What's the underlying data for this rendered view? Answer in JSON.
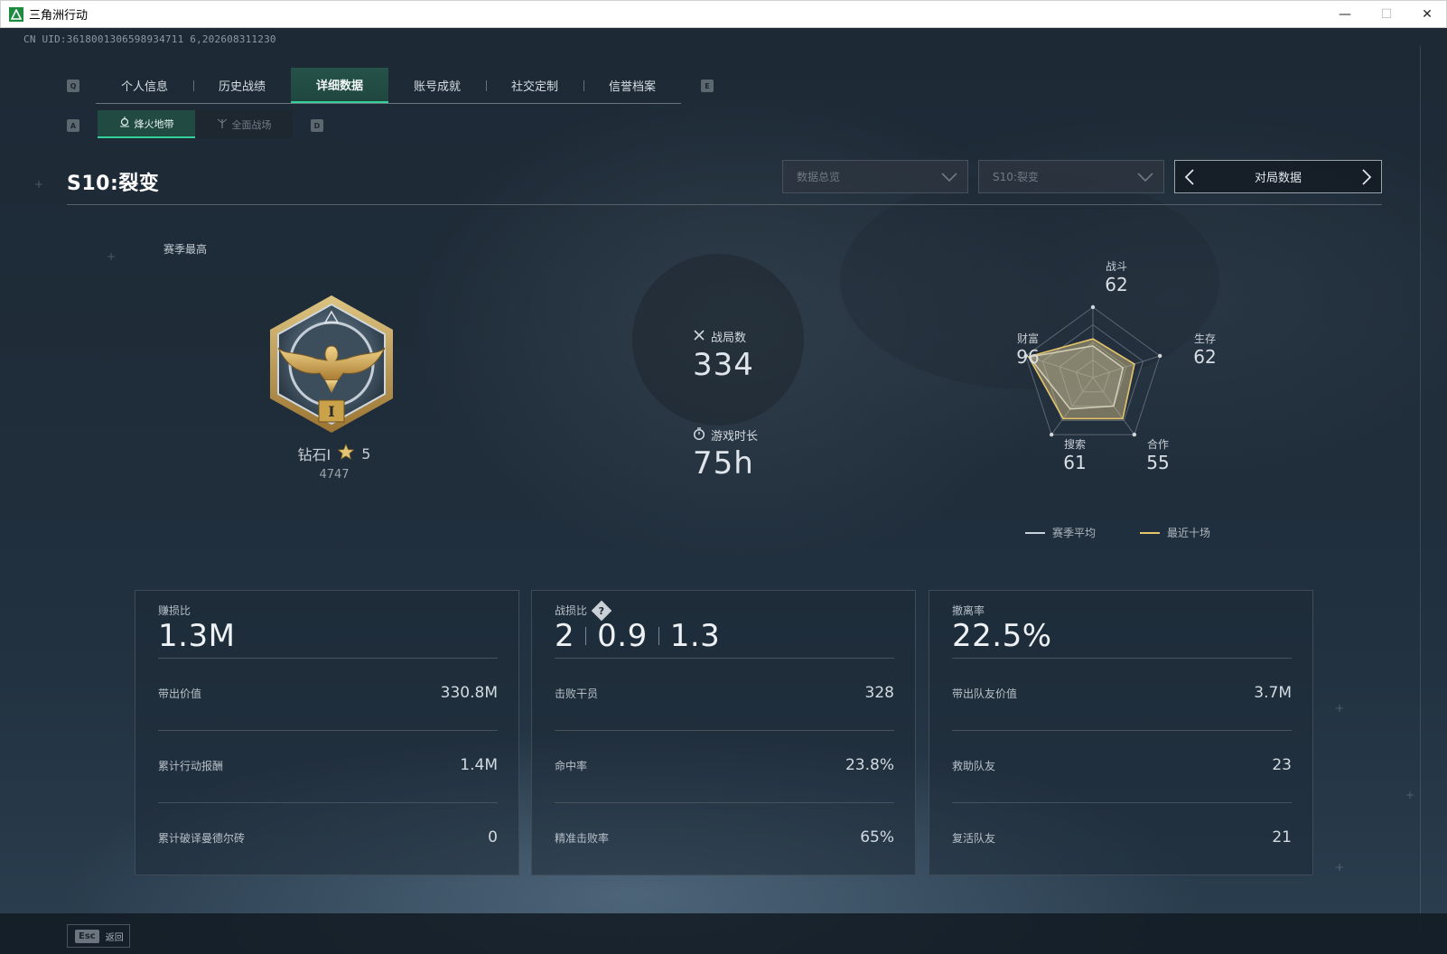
{
  "window": {
    "title": "三角洲行动",
    "minimize_glyph": "—",
    "maximize_glyph": "☐",
    "close_glyph": "✕"
  },
  "header": {
    "uid": "CN UID:3618001306598934711 6,202608311230",
    "key_q": "Q",
    "key_e": "E",
    "key_a": "A",
    "key_d": "D"
  },
  "tabs": [
    {
      "label": "个人信息"
    },
    {
      "label": "历史战绩"
    },
    {
      "label": "详细数据",
      "active": true
    },
    {
      "label": "账号成就"
    },
    {
      "label": "社交定制"
    },
    {
      "label": "信誉档案"
    }
  ],
  "subtabs": [
    {
      "label": "烽火地带",
      "icon": "crosshair-icon",
      "active": true
    },
    {
      "label": "全面战场",
      "icon": "antenna-icon"
    }
  ],
  "season": {
    "title": "S10:裂变",
    "dropdown_overview": "数据总览",
    "dropdown_season": "S10:裂变",
    "pager_label": "对局数据"
  },
  "rank": {
    "section_label": "赛季最高",
    "rank_name": "钻石I",
    "stars": "5",
    "points": "4747",
    "medal_numeral": "I"
  },
  "center_stats": {
    "matches_label": "战局数",
    "matches_value": "334",
    "playtime_label": "游戏时长",
    "playtime_value": "75h"
  },
  "radar": {
    "axes": [
      {
        "name": "战斗",
        "value": "62"
      },
      {
        "name": "生存",
        "value": "62"
      },
      {
        "name": "合作",
        "value": "55"
      },
      {
        "name": "搜索",
        "value": "61"
      },
      {
        "name": "财富",
        "value": "96"
      }
    ],
    "season_avg": [
      0.45,
      0.45,
      0.5,
      0.55,
      0.95
    ],
    "recent_ten": [
      0.55,
      0.62,
      0.72,
      0.72,
      0.96
    ],
    "legend_avg": "赛季平均",
    "legend_recent": "最近十场",
    "color_avg": "#c9d1d8",
    "color_recent": "#e6c56a"
  },
  "cards": [
    {
      "head_label": "赚损比",
      "head_value": "1.3M",
      "rows": [
        {
          "k": "带出价值",
          "v": "330.8M"
        },
        {
          "k": "累计行动报酬",
          "v": "1.4M"
        },
        {
          "k": "累计破译曼德尔砖",
          "v": "0"
        }
      ]
    },
    {
      "head_label": "战损比",
      "head_values": [
        "2",
        "0.9",
        "1.3"
      ],
      "help_glyph": "?",
      "rows": [
        {
          "k": "击败干员",
          "v": "328"
        },
        {
          "k": "命中率",
          "v": "23.8%"
        },
        {
          "k": "精准击败率",
          "v": "65%"
        }
      ]
    },
    {
      "head_label": "撤离率",
      "head_value": "22.5%",
      "rows": [
        {
          "k": "带出队友价值",
          "v": "3.7M"
        },
        {
          "k": "救助队友",
          "v": "23"
        },
        {
          "k": "复活队友",
          "v": "21"
        }
      ]
    }
  ],
  "footer": {
    "esc_key": "Esc",
    "back_label": "返回"
  },
  "colors": {
    "accent_green": "#34d29a",
    "active_tab_bg": "#255249",
    "medal_gold": "#c9a24a"
  }
}
